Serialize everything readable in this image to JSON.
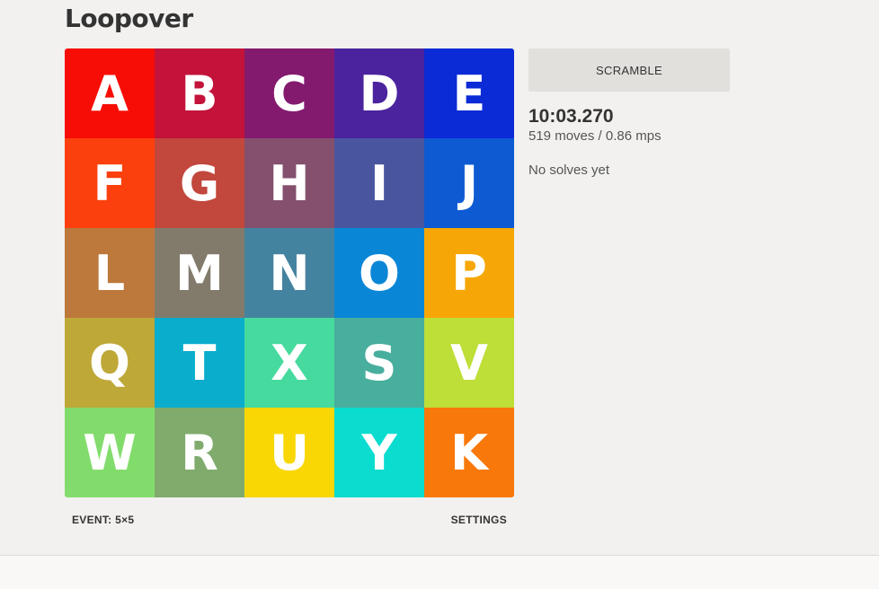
{
  "app": {
    "title": "Loopover"
  },
  "board": {
    "size": 5,
    "tiles": [
      {
        "letter": "A",
        "color": "#f70d06"
      },
      {
        "letter": "B",
        "color": "#c3133a"
      },
      {
        "letter": "C",
        "color": "#841a6e"
      },
      {
        "letter": "D",
        "color": "#4b239e"
      },
      {
        "letter": "E",
        "color": "#0b2bd6"
      },
      {
        "letter": "F",
        "color": "#fc400d"
      },
      {
        "letter": "G",
        "color": "#c2473d"
      },
      {
        "letter": "H",
        "color": "#84506e"
      },
      {
        "letter": "I",
        "color": "#49569f"
      },
      {
        "letter": "J",
        "color": "#0e5ad3"
      },
      {
        "letter": "L",
        "color": "#bd793c"
      },
      {
        "letter": "M",
        "color": "#827b6c"
      },
      {
        "letter": "N",
        "color": "#44839f"
      },
      {
        "letter": "O",
        "color": "#0a86d6"
      },
      {
        "letter": "P",
        "color": "#f6a707"
      },
      {
        "letter": "Q",
        "color": "#bea838"
      },
      {
        "letter": "T",
        "color": "#0aadcc"
      },
      {
        "letter": "X",
        "color": "#46da9e"
      },
      {
        "letter": "S",
        "color": "#48ae9d"
      },
      {
        "letter": "V",
        "color": "#bede38"
      },
      {
        "letter": "W",
        "color": "#82dc6c"
      },
      {
        "letter": "R",
        "color": "#80ab6d"
      },
      {
        "letter": "U",
        "color": "#f8d705"
      },
      {
        "letter": "Y",
        "color": "#0adcd0"
      },
      {
        "letter": "K",
        "color": "#f8780a"
      }
    ]
  },
  "footer": {
    "event_label": "EVENT: 5×5",
    "settings_label": "SETTINGS"
  },
  "panel": {
    "scramble_label": "SCRAMBLE",
    "timer": "10:03.270",
    "moves": "519 moves / 0.86 mps",
    "solves": "No solves yet"
  }
}
